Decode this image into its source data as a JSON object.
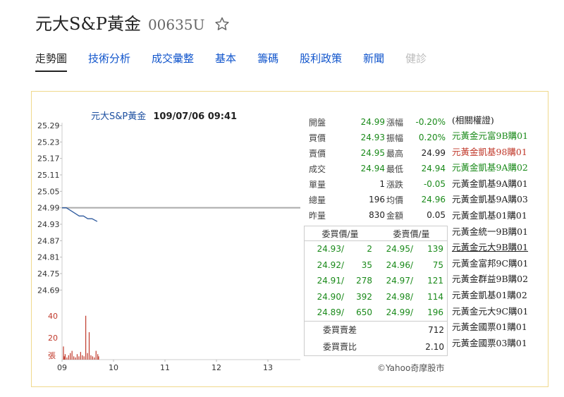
{
  "header": {
    "stock_name": "元大S&P黃金",
    "stock_code": "00635U",
    "favorite_icon": "star-outline-icon"
  },
  "tabs": [
    {
      "label": "走勢圖",
      "state": "active"
    },
    {
      "label": "技術分析",
      "state": "link"
    },
    {
      "label": "成交彙整",
      "state": "link"
    },
    {
      "label": "基本",
      "state": "link"
    },
    {
      "label": "籌碼",
      "state": "link"
    },
    {
      "label": "股利政策",
      "state": "link"
    },
    {
      "label": "新聞",
      "state": "link"
    },
    {
      "label": "健診",
      "state": "disabled"
    }
  ],
  "chart": {
    "title_name": "元大S&P黃金",
    "title_datetime": "109/07/06 09:41"
  },
  "chart_data": {
    "type": "line",
    "title": "元大S&P黃金 109/07/06 09:41",
    "x_ticks": [
      "09",
      "10",
      "11",
      "12",
      "13"
    ],
    "y_ticks": [
      "25.29",
      "25.23",
      "25.17",
      "25.11",
      "25.05",
      "24.99",
      "24.93",
      "24.87",
      "24.81",
      "24.75",
      "24.69"
    ],
    "ylim": [
      24.66,
      25.29
    ],
    "reference_line": 24.99,
    "series": [
      {
        "x": [
          "09:00",
          "09:05",
          "09:10",
          "09:15",
          "09:20",
          "09:25",
          "09:30",
          "09:35",
          "09:41"
        ],
        "values": [
          24.99,
          24.99,
          24.98,
          24.97,
          24.96,
          24.96,
          24.95,
          24.95,
          24.94
        ]
      }
    ],
    "volume_ticks": [
      "40",
      "20",
      "張"
    ],
    "volume": {
      "x": [
        "09:00",
        "09:01",
        "09:02",
        "09:04",
        "09:06",
        "09:08",
        "09:10",
        "09:12",
        "09:14",
        "09:16",
        "09:18",
        "09:20",
        "09:22",
        "09:24",
        "09:26",
        "09:28",
        "09:30",
        "09:32",
        "09:34",
        "09:36",
        "09:38",
        "09:40",
        "09:41"
      ],
      "values": [
        12,
        3,
        5,
        2,
        4,
        6,
        8,
        3,
        2,
        5,
        3,
        7,
        4,
        3,
        40,
        6,
        25,
        4,
        3,
        2,
        8,
        5,
        3
      ]
    },
    "colors": {
      "line": "#2e5a9e",
      "reference": "#aaaaaa",
      "volume": "#c0392b"
    }
  },
  "quote": [
    {
      "l1": "開盤",
      "v1": "24.99",
      "l2": "漲幅",
      "v2": "-0.20%",
      "c1": "g",
      "c2": "g"
    },
    {
      "l1": "買價",
      "v1": "24.93",
      "l2": "振幅",
      "v2": "0.20%",
      "c1": "g",
      "c2": "g"
    },
    {
      "l1": "賣價",
      "v1": "24.95",
      "l2": "最高",
      "v2": "24.99",
      "c1": "g",
      "c2": "b"
    },
    {
      "l1": "成交",
      "v1": "24.94",
      "l2": "最低",
      "v2": "24.94",
      "c1": "g",
      "c2": "g"
    },
    {
      "l1": "單量",
      "v1": "1",
      "l2": "漲跌",
      "v2": "-0.05",
      "c1": "b",
      "c2": "g"
    },
    {
      "l1": "總量",
      "v1": "196",
      "l2": "均價",
      "v2": "24.96",
      "c1": "b",
      "c2": "g"
    },
    {
      "l1": "昨量",
      "v1": "830",
      "l2": "金額",
      "v2": "0.05",
      "c1": "b",
      "c2": "b"
    }
  ],
  "order_book": {
    "bid_header": "委買價/量",
    "ask_header": "委賣價/量",
    "rows": [
      {
        "bp": "24.93/",
        "bq": "2",
        "sp": "24.95/",
        "sq": "139"
      },
      {
        "bp": "24.92/",
        "bq": "35",
        "sp": "24.96/",
        "sq": "75"
      },
      {
        "bp": "24.91/",
        "bq": "278",
        "sp": "24.97/",
        "sq": "121"
      },
      {
        "bp": "24.90/",
        "bq": "392",
        "sp": "24.98/",
        "sq": "114"
      },
      {
        "bp": "24.89/",
        "bq": "650",
        "sp": "24.99/",
        "sq": "196"
      }
    ],
    "diff_label": "委買賣差",
    "diff_value": "712",
    "ratio_label": "委買賣比",
    "ratio_value": "2.10"
  },
  "copyright": "©Yahoo奇摩股市",
  "warrants": {
    "title": "(相關權證)",
    "items": [
      {
        "label": "元黃金元富9B購01",
        "style": "green"
      },
      {
        "label": "元黃金凱基98購01",
        "style": "red"
      },
      {
        "label": "元黃金凱基9A購02",
        "style": "green"
      },
      {
        "label": "元黃金凱基9A購01",
        "style": "black"
      },
      {
        "label": "元黃金凱基9A購03",
        "style": "black"
      },
      {
        "label": "元黃金凱基01購01",
        "style": "black"
      },
      {
        "label": "元黃金統一9B購01",
        "style": "black"
      },
      {
        "label": "元黃金元大9B購01",
        "style": "underline"
      },
      {
        "label": "元黃金富邦9C購01",
        "style": "black"
      },
      {
        "label": "元黃金群益9B購02",
        "style": "black"
      },
      {
        "label": "元黃金凱基01購02",
        "style": "black"
      },
      {
        "label": "元黃金元大9C購01",
        "style": "black"
      },
      {
        "label": "元黃金國票01購01",
        "style": "black"
      },
      {
        "label": "元黃金國票03購01",
        "style": "black"
      }
    ]
  }
}
